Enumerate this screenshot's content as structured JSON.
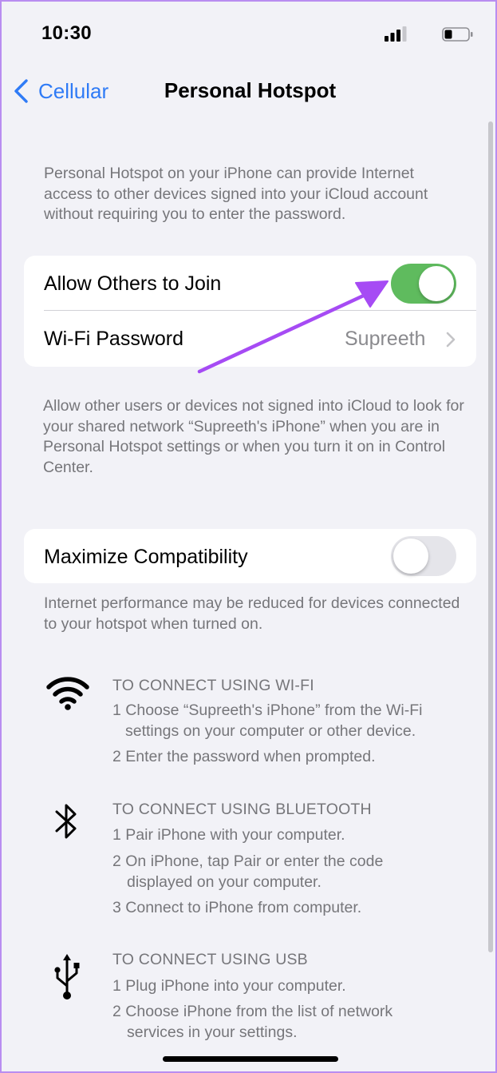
{
  "status_bar": {
    "time": "10:30",
    "signal_icon": "cellular-signal-icon",
    "battery_icon": "battery-icon"
  },
  "nav": {
    "back_label": "Cellular",
    "title": "Personal Hotspot"
  },
  "intro_text": "Personal Hotspot on your iPhone can provide Internet access to other devices signed into your iCloud account without requiring you to enter the password.",
  "settings_group_1": {
    "allow_others_label": "Allow Others to Join",
    "allow_others_on": true,
    "wifi_password_label": "Wi-Fi Password",
    "wifi_password_value": "Supreeth"
  },
  "allow_footer": "Allow other users or devices not signed into iCloud to look for your shared network “Supreeth's iPhone” when you are in Personal Hotspot settings or when you turn it on in Control Center.",
  "settings_group_2": {
    "max_compat_label": "Maximize Compatibility",
    "max_compat_on": false
  },
  "compat_footer": "Internet performance may be reduced for devices connected to your hotspot when turned on.",
  "instructions": {
    "wifi": {
      "icon": "wifi-icon",
      "heading": "TO CONNECT USING WI-FI",
      "step1_a": "1 Choose “Supreeth's iPhone” from the Wi-Fi",
      "step1_b": "settings on your computer or other device.",
      "step2": "2 Enter the password when prompted."
    },
    "bluetooth": {
      "icon": "bluetooth-icon",
      "heading": "TO CONNECT USING BLUETOOTH",
      "step1": "1 Pair iPhone with your computer.",
      "step2_a": "2 On iPhone, tap Pair or enter the code",
      "step2_b": "displayed on your computer.",
      "step3": "3 Connect to iPhone from computer."
    },
    "usb": {
      "icon": "usb-icon",
      "heading": "TO CONNECT USING USB",
      "step1": "1 Plug iPhone into your computer.",
      "step2_a": "2 Choose iPhone from the list of network",
      "step2_b": "services in your settings."
    }
  },
  "colors": {
    "accent_blue": "#2f7bf6",
    "toggle_on": "#5fbb5e",
    "annotation_arrow": "#a64bf4"
  }
}
